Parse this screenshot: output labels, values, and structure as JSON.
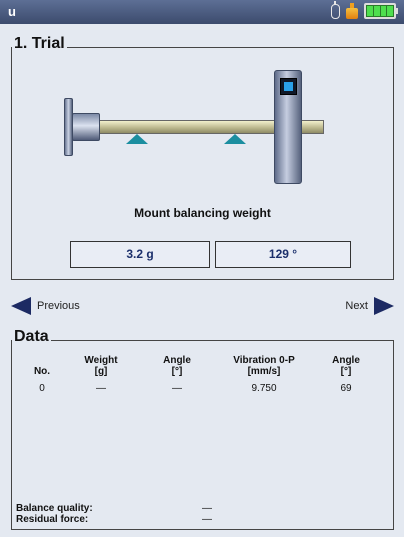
{
  "statusbar": {
    "title": "u",
    "icons": [
      "sensor-icon",
      "weight-icon",
      "battery-icon"
    ]
  },
  "trial": {
    "title": "1. Trial",
    "instruction": "Mount balancing weight",
    "weight_value": "3.2 g",
    "angle_value": "129 °"
  },
  "navigation": {
    "previous_label": "Previous",
    "next_label": "Next"
  },
  "data": {
    "title": "Data",
    "columns": [
      {
        "line1": "No.",
        "line2": ""
      },
      {
        "line1": "Weight",
        "line2": "[g]"
      },
      {
        "line1": "Angle",
        "line2": "[°]"
      },
      {
        "line1": "Vibration 0-P",
        "line2": "[mm/s]"
      },
      {
        "line1": "Angle",
        "line2": "[°]"
      }
    ],
    "rows": [
      [
        "0",
        "—",
        "—",
        "9.750",
        "69"
      ]
    ],
    "balance_quality_label": "Balance quality:",
    "balance_quality_value": "—",
    "residual_force_label": "Residual force:",
    "residual_force_value": "—"
  },
  "colors": {
    "header_bg": "#4a5a7e",
    "accent_navy": "#1c2a63",
    "battery_green": "#4ede4e",
    "bearing_teal": "#1b8ea0"
  }
}
